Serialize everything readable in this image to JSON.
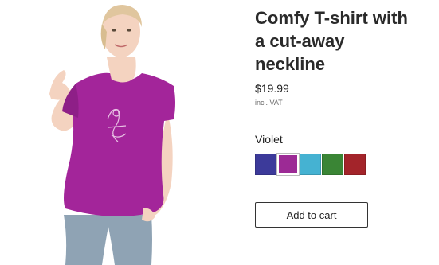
{
  "product": {
    "title": "Comfy T-shirt with a cut-away neckline",
    "price": "$19.99",
    "tax_note": "incl. VAT",
    "selected_color": "Violet",
    "swatches": [
      {
        "name": "Blue",
        "color": "#3c3a9a"
      },
      {
        "name": "Violet",
        "color": "#9c2a95",
        "selected": true
      },
      {
        "name": "Light Blue",
        "color": "#45b2d2"
      },
      {
        "name": "Green",
        "color": "#3a8535"
      },
      {
        "name": "Red",
        "color": "#a3242a"
      }
    ],
    "cart_button_label": "Add to cart"
  },
  "colors": {
    "shirt": "#a3259a",
    "skin": "#f4d3c0",
    "hair": "#e0c69e",
    "jeans": "#8fa3b4"
  }
}
